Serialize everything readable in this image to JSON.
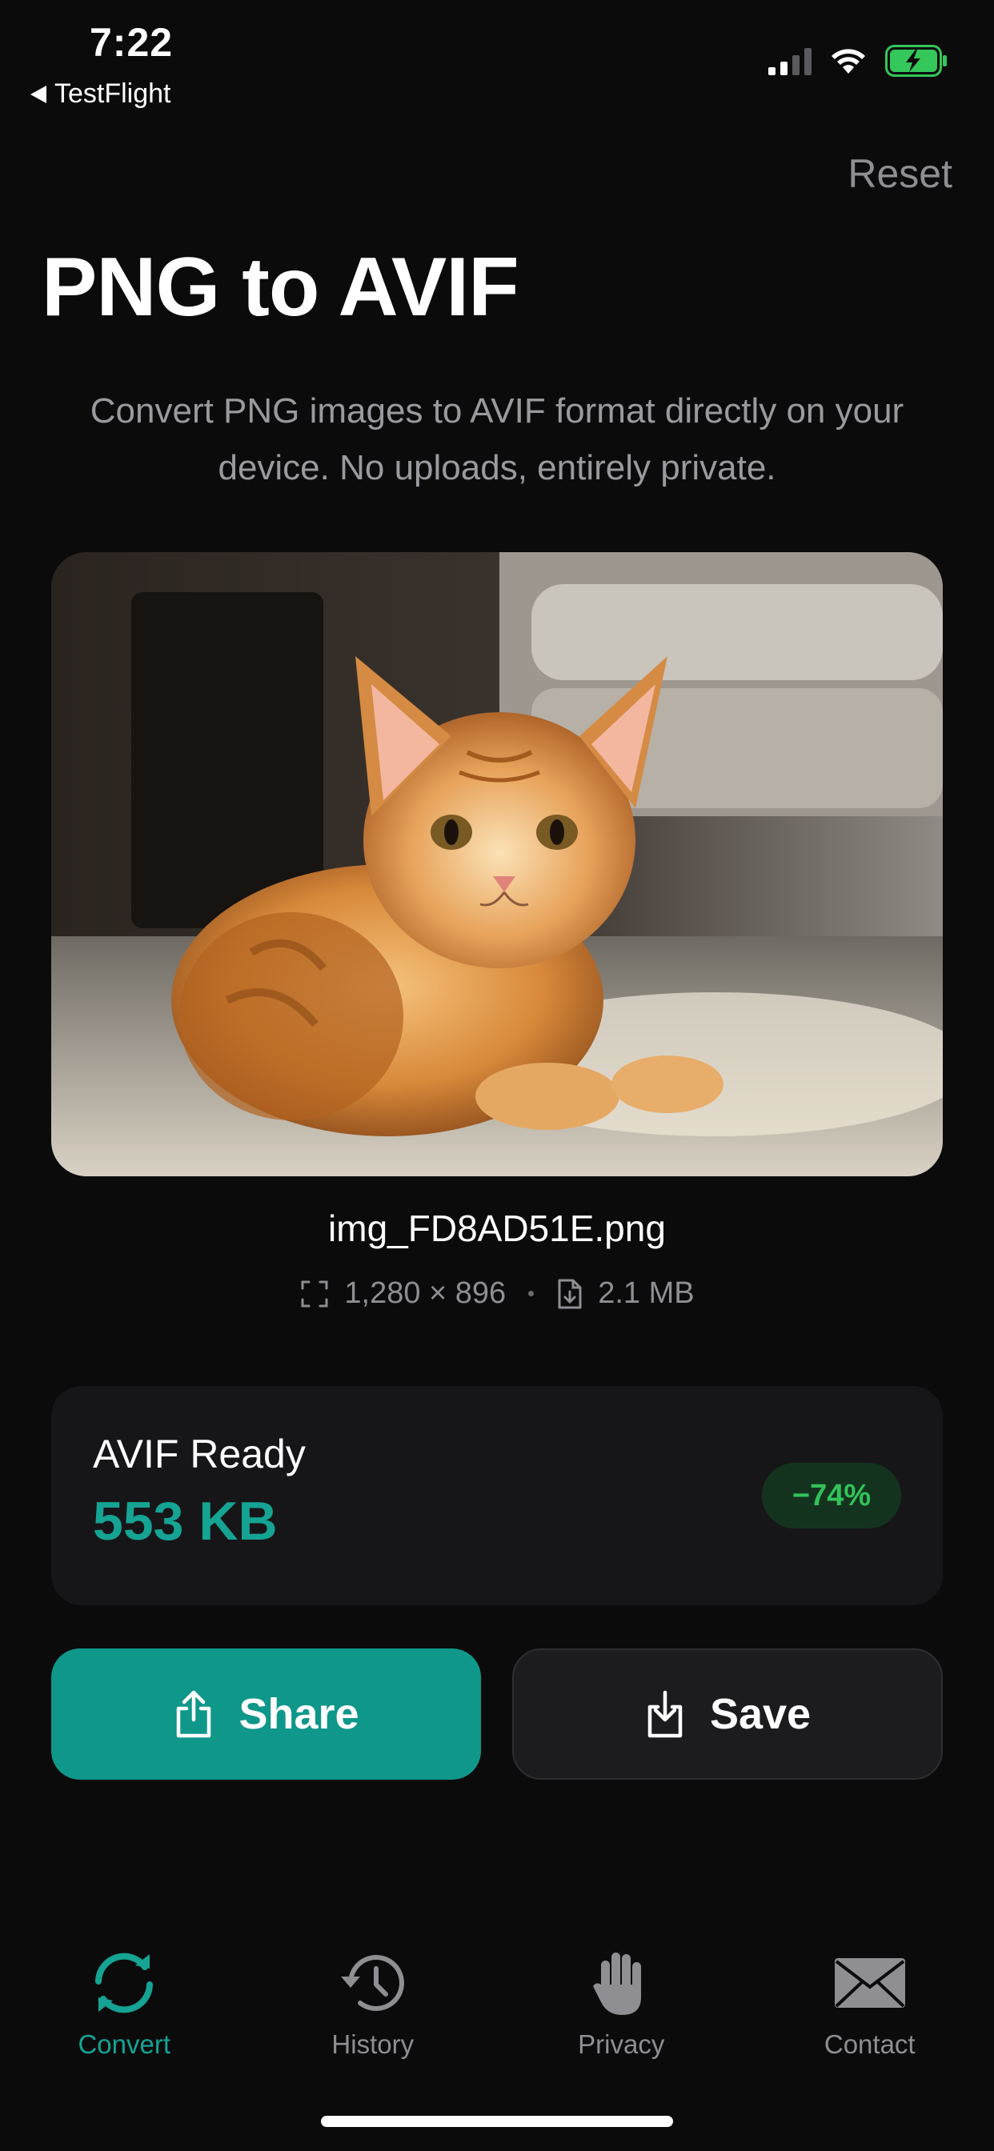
{
  "status_bar": {
    "time": "7:22",
    "back_label": "TestFlight",
    "battery_color": "#34c759"
  },
  "header": {
    "reset_label": "Reset",
    "title": "PNG to AVIF",
    "subtitle": "Convert PNG images to AVIF format directly on your device. No uploads, entirely private."
  },
  "source_file": {
    "preview_subject": "orange tabby cat lying on carpet",
    "filename": "img_FD8AD51E.png",
    "dimensions": "1,280 × 896",
    "size": "2.1 MB"
  },
  "result": {
    "label": "AVIF Ready",
    "size": "553 KB",
    "reduction": "−74%",
    "accent_color": "#15a393"
  },
  "actions": {
    "share_label": "Share",
    "save_label": "Save"
  },
  "tabbar": {
    "active": "Convert",
    "tabs": [
      {
        "label": "Convert",
        "icon": "convert-arrows-icon"
      },
      {
        "label": "History",
        "icon": "history-clock-icon"
      },
      {
        "label": "Privacy",
        "icon": "hand-icon"
      },
      {
        "label": "Contact",
        "icon": "envelope-icon"
      }
    ]
  }
}
